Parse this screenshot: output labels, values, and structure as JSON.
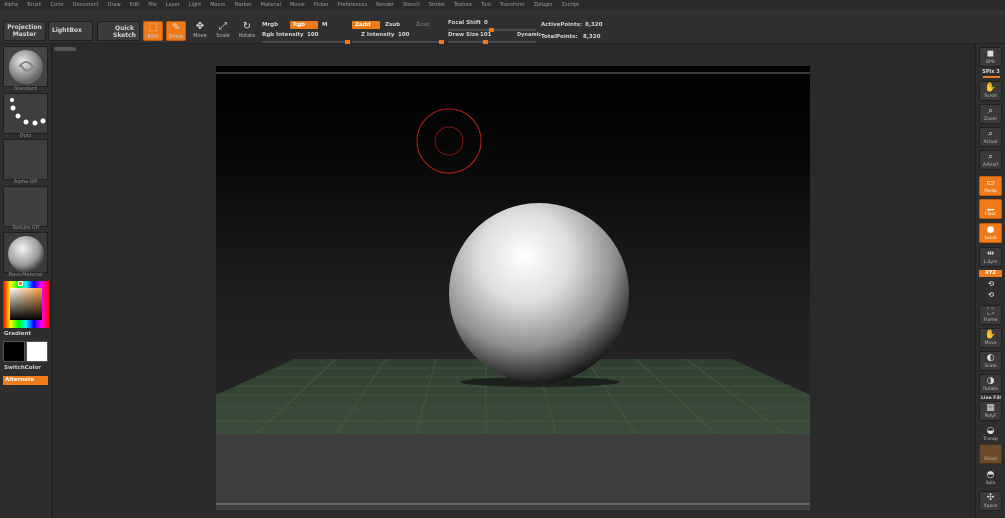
{
  "menu": [
    "Alpha",
    "Brush",
    "Color",
    "Document",
    "Draw",
    "Edit",
    "File",
    "Layer",
    "Light",
    "Macro",
    "Marker",
    "Material",
    "Movie",
    "Picker",
    "Preferences",
    "Render",
    "Stencil",
    "Stroke",
    "Texture",
    "Tool",
    "Transform",
    "Zplugin",
    "Zscript"
  ],
  "toolbar": {
    "projection_master": "Projection Master",
    "lightbox": "LightBox",
    "quick_sketch": "Quick Sketch",
    "edit": "Edit",
    "draw": "Draw",
    "move": "Move",
    "scale": "Scale",
    "rotate": "Rotate",
    "mrgb": "Mrgb",
    "rgb": "Rgb",
    "m": "M",
    "zadd": "Zadd",
    "zsub": "Zsub",
    "zcut": "Zcut",
    "rgb_intensity_label": "Rgb Intensity",
    "rgb_intensity": "100",
    "z_intensity_label": "Z Intensity",
    "z_intensity": "100",
    "focal_shift_label": "Focal Shift",
    "focal_shift": "0",
    "draw_size_label": "Draw Size",
    "draw_size": "101",
    "dynamic": "Dynamic",
    "active_points_label": "ActivePoints:",
    "active_points": "8,320",
    "total_points_label": "TotalPoints:",
    "total_points": "8,320"
  },
  "left": {
    "brush": "Standard",
    "stroke": "Dots",
    "alpha": "Alpha Off",
    "texture": "Texture Off",
    "material": "BasicMaterial",
    "gradient": "Gradient",
    "switch_color": "SwitchColor",
    "alternate": "Alternate"
  },
  "right": {
    "bpr": "BPR",
    "spix_label": "SPix",
    "spix": "3",
    "scroll": "Scroll",
    "zoom": "Zoom",
    "actual": "Actual",
    "aahalf": "AAHalf",
    "persp": "Persp",
    "floor": "Floor",
    "local": "Local",
    "lsym": "L.Sym",
    "xyz": "XYZ",
    "frame": "Frame",
    "move": "Move",
    "scale": "Scale",
    "rotate": "Rotate",
    "line_fill": "Line Fill",
    "polyf": "PolyF",
    "transp": "Transp",
    "ghost": "Ghost",
    "solo": "Solo",
    "xpose": "Xpose"
  },
  "colors": {
    "accent": "#f07a18",
    "main_color": "#000000",
    "secondary_color": "#ffffff",
    "floor_grid": "#3c5c3c"
  }
}
